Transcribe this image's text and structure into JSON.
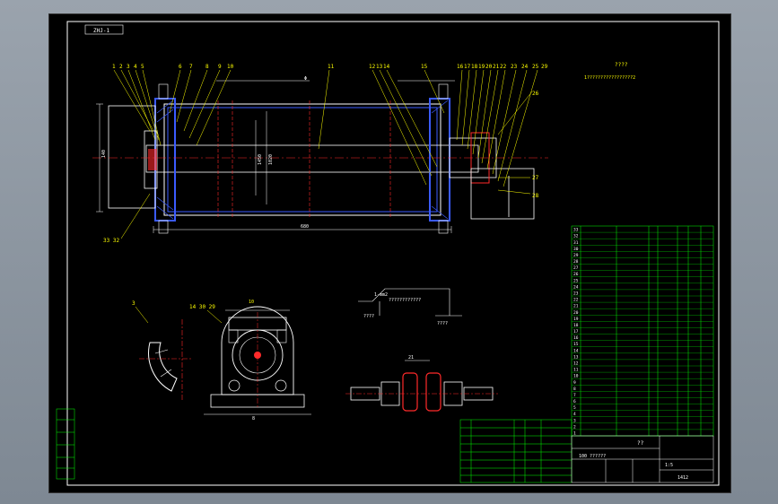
{
  "title_tag": "ZHJ-1",
  "part_numbers_left": [
    "1",
    "2",
    "3",
    "4",
    "5",
    "6",
    "7",
    "8",
    "9",
    "10",
    "11"
  ],
  "part_numbers_mid": [
    "12",
    "13",
    "14",
    "15"
  ],
  "part_numbers_right": [
    "16",
    "17",
    "18",
    "19",
    "20",
    "21",
    "22",
    "23",
    "24",
    "25"
  ],
  "callouts": {
    "c26": "26",
    "c27": "27",
    "c28": "28",
    "c29": "29",
    "c33": "33 32"
  },
  "dims": {
    "length": "680",
    "height_a": "1450",
    "height_b": "1020",
    "bearing_w": "140",
    "top_mark": "Φ"
  },
  "notes_title": "????",
  "notes_line": "1?????????????????2",
  "detail_labels": {
    "a": "3",
    "b": "14 30 29",
    "c": "10",
    "d": "8",
    "e": "21"
  },
  "weld_labels": {
    "l1": "1-mm2",
    "l2": "????????????",
    "l3": "????",
    "l4": "????"
  },
  "bom_rows": [
    "33",
    "32",
    "31",
    "30",
    "29",
    "28",
    "27",
    "26",
    "25",
    "24",
    "23",
    "22",
    "21",
    "20",
    "19",
    "18",
    "17",
    "16",
    "15",
    "14",
    "13",
    "12",
    "11",
    "10",
    "9",
    "8",
    "7",
    "6",
    "5",
    "4",
    "3",
    "2",
    "1"
  ],
  "title_block": {
    "name": "??",
    "drawing_no": "100 ??????",
    "scale": "1:5",
    "sheet": "1412"
  },
  "colors": {
    "bg": "#000000",
    "outline": "#ffffff",
    "yellow": "#ffff00",
    "red": "#ff2a2a",
    "cyan": "#00e5ff",
    "blue": "#3b5bff",
    "green": "#00ff44"
  }
}
